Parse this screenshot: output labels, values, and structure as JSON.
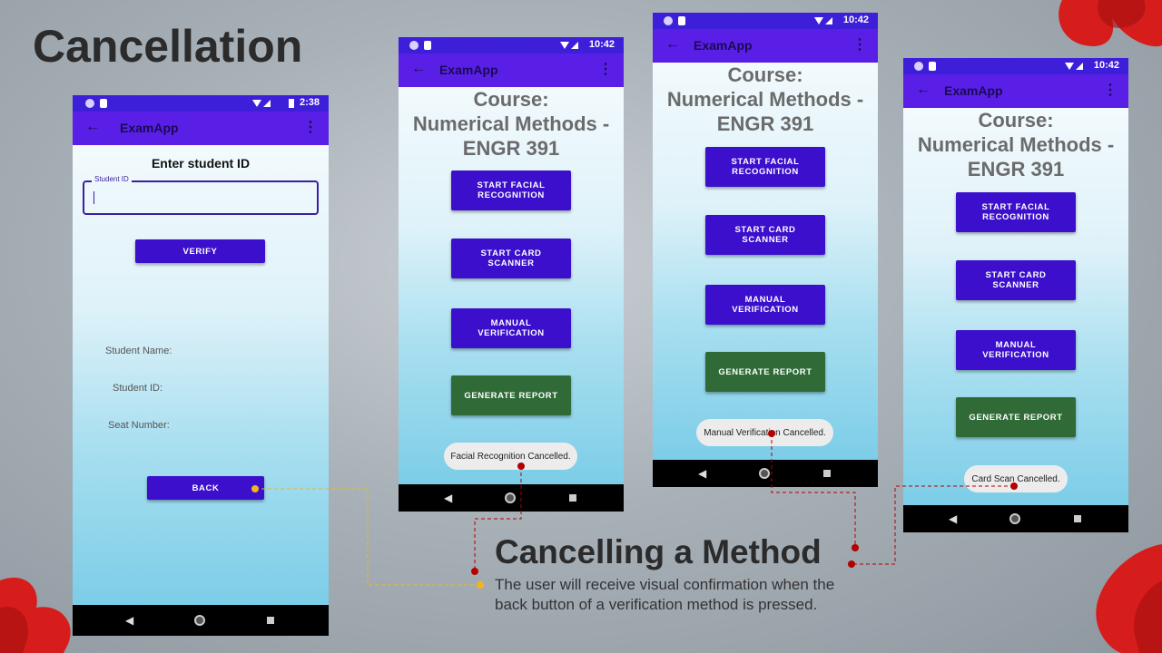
{
  "slide": {
    "title": "Cancellation",
    "caption_title": "Cancelling a Method",
    "caption_body": "The user will receive visual confirmation when the back button of a verification method is pressed."
  },
  "app_name": "ExamApp",
  "phone1": {
    "time": "2:38",
    "heading": "Enter student ID",
    "field_label": "Student ID",
    "field_value": "",
    "verify_label": "VERIFY",
    "student_name_label": "Student Name:",
    "student_id_label": "Student ID:",
    "seat_number_label": "Seat Number:",
    "back_label": "BACK"
  },
  "course_screen": {
    "time": "10:42",
    "course_label": "Course:",
    "course_name": "Numerical Methods -",
    "course_code": "ENGR 391",
    "facial_label": "START FACIAL RECOGNITION",
    "card_label": "START CARD SCANNER",
    "manual_label": "MANUAL VERIFICATION",
    "report_label": "GENERATE REPORT"
  },
  "toasts": {
    "facial": "Facial Recognition Cancelled.",
    "manual": "Manual Verification Cancelled.",
    "card": "Card Scan Cancelled."
  },
  "colors": {
    "app_bar": "#5a1fe6",
    "status_bar": "#3d1fd9",
    "button": "#3b0fcc",
    "report_button": "#2f6a37",
    "connector_yellow": "#f2b51d",
    "connector_red": "#b30000"
  },
  "icons": [
    "back-arrow-icon",
    "overflow-menu-icon",
    "wifi-icon",
    "battery-icon",
    "nav-back-icon",
    "nav-home-icon",
    "nav-recents-icon"
  ]
}
